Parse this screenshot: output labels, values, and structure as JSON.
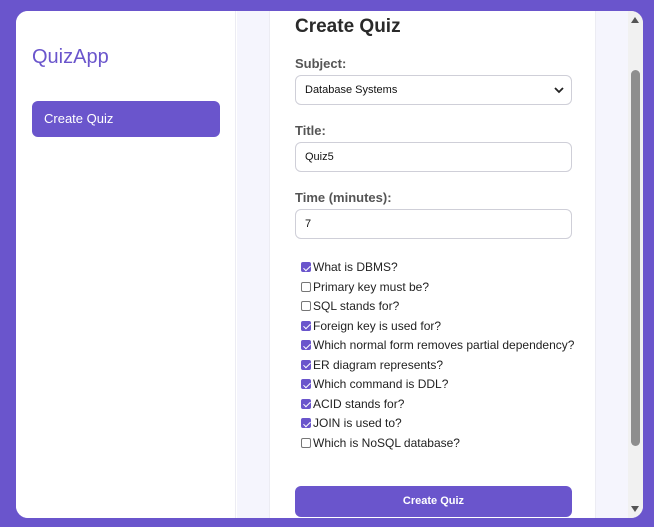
{
  "sidebar": {
    "logo": "QuizApp",
    "nav": [
      {
        "label": "Create Quiz",
        "active": true
      }
    ]
  },
  "form": {
    "heading": "Create Quiz",
    "subject_label": "Subject:",
    "subject_value": "Database Systems",
    "title_label": "Title:",
    "title_value": "Quiz5",
    "time_label": "Time (minutes):",
    "time_value": "7",
    "questions": [
      {
        "text": "What is DBMS?",
        "checked": true
      },
      {
        "text": "Primary key must be?",
        "checked": false
      },
      {
        "text": "SQL stands for?",
        "checked": false
      },
      {
        "text": "Foreign key is used for?",
        "checked": true
      },
      {
        "text": "Which normal form removes partial dependency?",
        "checked": true
      },
      {
        "text": "ER diagram represents?",
        "checked": true
      },
      {
        "text": "Which command is DDL?",
        "checked": true
      },
      {
        "text": "ACID stands for?",
        "checked": true
      },
      {
        "text": "JOIN is used to?",
        "checked": true
      },
      {
        "text": "Which is NoSQL database?",
        "checked": false
      }
    ],
    "submit_label": "Create Quiz"
  },
  "colors": {
    "accent": "#6a55cc",
    "background": "#f5f5fd"
  }
}
